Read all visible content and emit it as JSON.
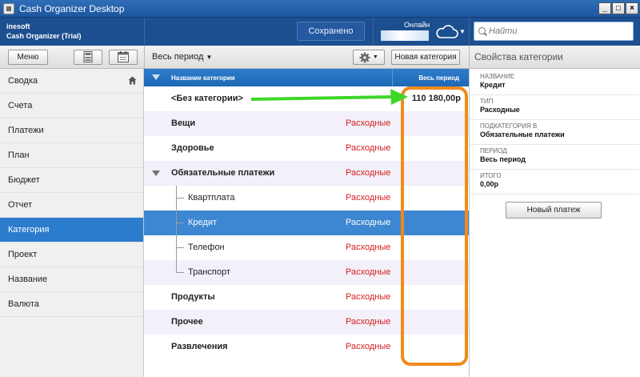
{
  "window": {
    "title": "Cash Organizer Desktop"
  },
  "header": {
    "company_line1": "inesoft",
    "company_line2": "Cash Organizer (Trial)",
    "saved_label": "Сохранено",
    "online_label": "Онлайн",
    "search_placeholder": "Найти"
  },
  "toolbar": {
    "menu_label": "Меню",
    "period_label": "Весь период",
    "new_category_label": "Новая категория",
    "properties_title": "Свойства категории"
  },
  "sidebar": {
    "items": [
      {
        "label": "Сводка"
      },
      {
        "label": "Счета"
      },
      {
        "label": "Платежи"
      },
      {
        "label": "План"
      },
      {
        "label": "Бюджет"
      },
      {
        "label": "Отчет"
      },
      {
        "label": "Категория"
      },
      {
        "label": "Проект"
      },
      {
        "label": "Название"
      },
      {
        "label": "Валюта"
      }
    ]
  },
  "table": {
    "headers": {
      "name": "Название категории",
      "period": "Весь период"
    },
    "rows": [
      {
        "name": "<Без категории>",
        "type": "",
        "amount": "110 180,00р"
      },
      {
        "name": "Вещи",
        "type": "Расходные",
        "amount": ""
      },
      {
        "name": "Здоровье",
        "type": "Расходные",
        "amount": ""
      },
      {
        "name": "Обязательные платежи",
        "type": "Расходные",
        "amount": ""
      },
      {
        "name": "Квартплата",
        "type": "Расходные",
        "amount": ""
      },
      {
        "name": "Кредит",
        "type": "Расходные",
        "amount": ""
      },
      {
        "name": "Телефон",
        "type": "Расходные",
        "amount": ""
      },
      {
        "name": "Транспорт",
        "type": "Расходные",
        "amount": ""
      },
      {
        "name": "Продукты",
        "type": "Расходные",
        "amount": ""
      },
      {
        "name": "Прочее",
        "type": "Расходные",
        "amount": ""
      },
      {
        "name": "Развлечения",
        "type": "Расходные",
        "amount": ""
      }
    ]
  },
  "properties": {
    "name_label": "НАЗВАНИЕ",
    "name_value": "Кредит",
    "type_label": "ТИП",
    "type_value": "Расходные",
    "parent_label": "ПОДКАТЕГОРИЯ В",
    "parent_value": "Обязательные платежи",
    "period_label": "ПЕРИОД",
    "period_value": "Весь период",
    "total_label": "ИТОГО",
    "total_value": "0,00р",
    "new_payment_label": "Новый платеж"
  },
  "colors": {
    "header_bg": "#1c4f8f",
    "selection": "#3d86d2",
    "expense_text": "#d42020",
    "annotation_arrow": "#3fd62a",
    "annotation_frame": "#f08a1c"
  }
}
